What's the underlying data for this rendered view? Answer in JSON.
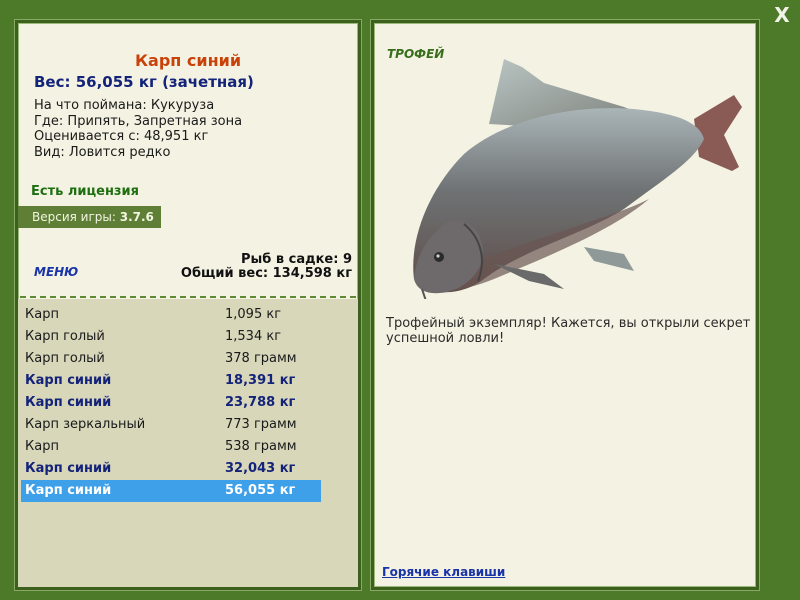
{
  "window": {
    "close_label": "X"
  },
  "catch": {
    "fish_name": "Карп синий",
    "weight_line": "Вес: 56,055 кг (зачетная)",
    "bait_line": "На что поймана: Кукуруза",
    "location_line": "Где: Припять, Запретная зона",
    "valued_line": "Оценивается с: 48,951 кг",
    "type_line": "Вид: Ловится редко"
  },
  "license": "Есть лицензия",
  "version": {
    "label": "Версия игры:",
    "value": "3.7.6"
  },
  "menu_label": "МЕНЮ",
  "cage": {
    "count_line": "Рыб в садке: 9",
    "total_line": "Общий вес: 134,598 кг"
  },
  "fish_list": [
    {
      "name": "Карп",
      "weight": "1,095 кг",
      "trophy": false
    },
    {
      "name": "Карп голый",
      "weight": "1,534 кг",
      "trophy": false
    },
    {
      "name": "Карп голый",
      "weight": "378 грамм",
      "trophy": false
    },
    {
      "name": "Карп синий",
      "weight": "18,391 кг",
      "trophy": true
    },
    {
      "name": "Карп синий",
      "weight": "23,788 кг",
      "trophy": true
    },
    {
      "name": "Карп зеркальный",
      "weight": "773 грамм",
      "trophy": false
    },
    {
      "name": "Карп",
      "weight": "538 грамм",
      "trophy": false
    },
    {
      "name": "Карп синий",
      "weight": "32,043 кг",
      "trophy": true
    },
    {
      "name": "Карп синий",
      "weight": "56,055 кг",
      "trophy": true,
      "selected": true
    }
  ],
  "right": {
    "trophy_label": "ТРОФЕЙ",
    "description": "Трофейный экземпляр! Кажется, вы открыли секрет успешной ловли!",
    "hotkeys_label": "Горячие клавиши"
  },
  "colors": {
    "background": "#4d7a28",
    "panel": "#f4f3e3",
    "list_background": "#d8d7ba",
    "selection": "#3fa0ea",
    "title": "#c8420a",
    "trophy_text": "#14237a",
    "license_text": "#1f6e12"
  },
  "icons": {
    "close": "close-icon",
    "fish": "carp-fish-image"
  }
}
